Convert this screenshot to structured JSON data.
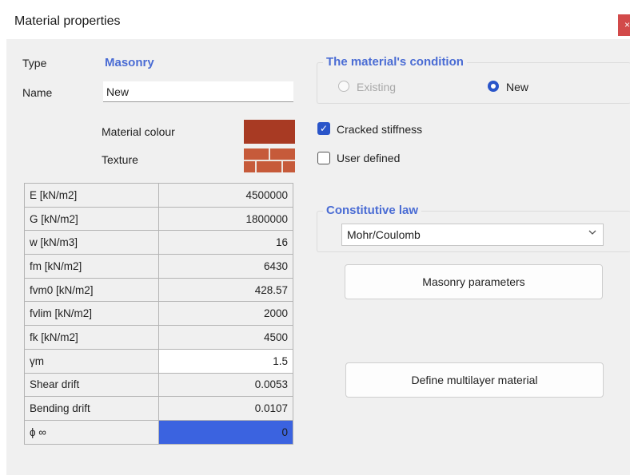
{
  "window": {
    "title": "Material properties",
    "close_label": "×"
  },
  "general": {
    "type_label": "Type",
    "type_value": "Masonry",
    "name_label": "Name",
    "name_value": "New",
    "colour_label": "Material colour",
    "texture_label": "Texture",
    "colour_hex": "#a83a23",
    "texture_hex": "#c65a3a"
  },
  "properties": [
    {
      "key": "E [kN/m2]",
      "value": "4500000"
    },
    {
      "key": "G [kN/m2]",
      "value": "1800000"
    },
    {
      "key": "w [kN/m3]",
      "value": "16"
    },
    {
      "key": "fm [kN/m2]",
      "value": "6430"
    },
    {
      "key": "fvm0 [kN/m2]",
      "value": "428.57"
    },
    {
      "key": "fvlim [kN/m2]",
      "value": "2000"
    },
    {
      "key": "fk [kN/m2]",
      "value": "4500"
    },
    {
      "key": "γm",
      "value": "1.5"
    },
    {
      "key": "Shear drift",
      "value": "0.0053"
    },
    {
      "key": "Bending drift",
      "value": "0.0107"
    },
    {
      "key": "ϕ ∞",
      "value": "0"
    }
  ],
  "condition": {
    "title": "The material's condition",
    "existing_label": "Existing",
    "new_label": "New",
    "selected": "New"
  },
  "options": {
    "cracked_label": "Cracked stiffness",
    "cracked_checked": true,
    "user_defined_label": "User defined",
    "user_defined_checked": false
  },
  "constitutive": {
    "title": "Constitutive law",
    "selected": "Mohr/Coulomb"
  },
  "buttons": {
    "masonry_parameters": "Masonry parameters",
    "define_multilayer": "Define multilayer material"
  },
  "colors": {
    "accent": "#2a55c9",
    "heading": "#4a6cd4",
    "selected_cell": "#3b63e0"
  }
}
